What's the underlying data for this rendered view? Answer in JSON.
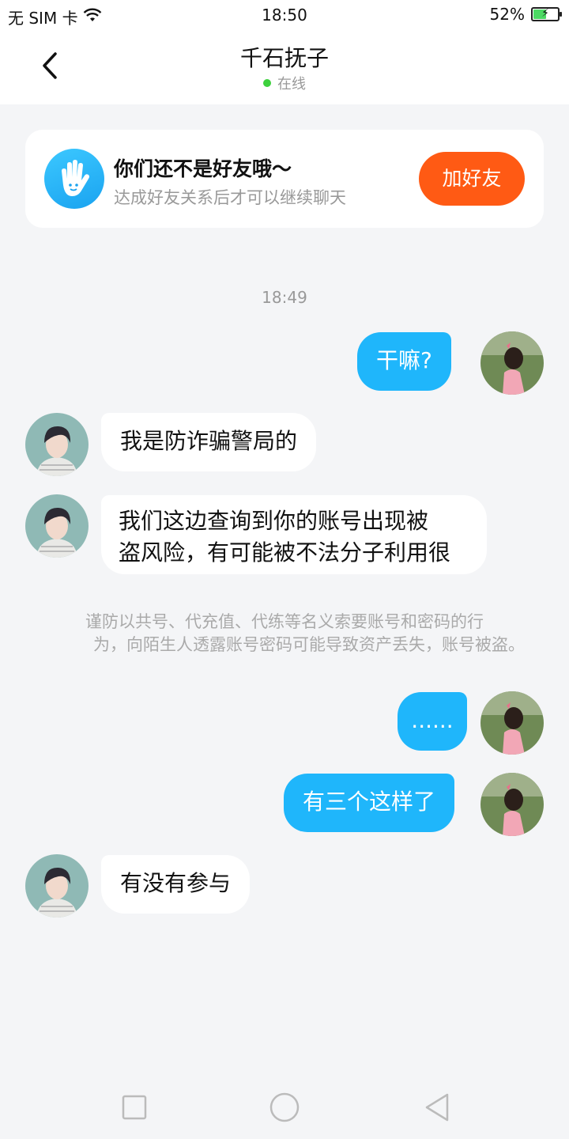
{
  "status_bar": {
    "carrier": "无 SIM 卡",
    "time": "18:50",
    "battery": "52%",
    "battery_level": 0.52,
    "icons": [
      "wifi-icon",
      "battery-charging-icon"
    ]
  },
  "header": {
    "title": "千石抚子",
    "status": "在线",
    "back_icon": "chevron-left-icon"
  },
  "friend_card": {
    "title": "你们还不是好友哦～",
    "subtitle": "达成好友关系后才可以继续聊天",
    "button": "加好友",
    "icon": "waving-hand-icon"
  },
  "chat": {
    "timestamp": "18:49",
    "messages": [
      {
        "from": "me",
        "text": "干嘛?"
      },
      {
        "from": "them",
        "text": "我是防诈骗警局的"
      },
      {
        "from": "them",
        "line1": "我们这边查询到你的账号出现被",
        "line2": "盗风险，有可能被不法分子利用很"
      },
      {
        "from": "me",
        "text": "......"
      },
      {
        "from": "me",
        "text": "有三个这样了"
      },
      {
        "from": "them",
        "text": "有没有参与"
      }
    ],
    "warning_line1": "谨防以共号、代充值、代练等名义索要账号和密码的行",
    "warning_line2": "为，向陌生人透露账号密码可能导致资产丢失，账号被盗。"
  },
  "nav_bar": {
    "icons": [
      "square-recents-icon",
      "circle-home-icon",
      "triangle-back-icon"
    ]
  },
  "colors": {
    "accent_blue": "#1fb6fb",
    "add_button": "#ff5a14",
    "online_dot": "#3dd13d",
    "background": "#f4f5f7"
  }
}
